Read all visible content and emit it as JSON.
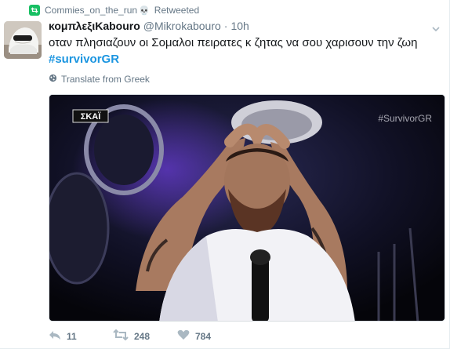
{
  "retweet_context": {
    "user": "Commies_on_the_run",
    "suffix_icon": "skull-icon",
    "label": "Retweeted"
  },
  "author": {
    "fullname": "κομπλεξιKabouro",
    "username": "@Mikrokabouro",
    "separator": "·",
    "time": "10h"
  },
  "tweet": {
    "text": "οταν πλησιαζουν οι Σομαλοι πειρατες κ ζητας να σου χαρισουν την ζωη",
    "hashtag": "#survivorGR"
  },
  "translate": {
    "label": "Translate from Greek",
    "icon": "globe-icon"
  },
  "media": {
    "channel_logo": "ΣΚΑΪ",
    "watermark": "#SurvivorGR"
  },
  "actions": {
    "reply_count": "11",
    "retweet_count": "248",
    "like_count": "784"
  },
  "colors": {
    "retweet_green": "#17bf63",
    "hashtag_blue": "#1b95e0",
    "meta_gray": "#657786"
  }
}
